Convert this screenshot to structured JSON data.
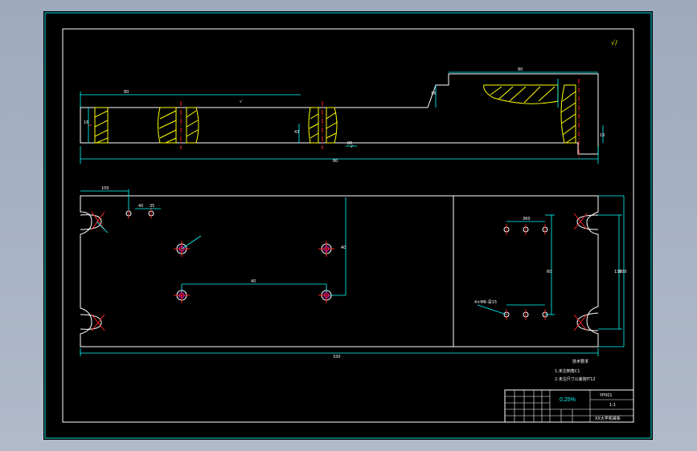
{
  "drawing": {
    "top_view": {
      "dims": [
        "80",
        "80",
        "16",
        "16",
        "80",
        "16",
        "43",
        "80"
      ],
      "roughness": [
        "√",
        "√"
      ]
    },
    "plan_view": {
      "dims": [
        "100",
        "40",
        "35",
        "40",
        "40",
        "330",
        "130",
        "100",
        "60",
        "360"
      ],
      "hole_note": "4×M8-深15"
    },
    "notes": {
      "heading": "技术要求",
      "lines": [
        "1.未注倒角C1",
        "2.未注尺寸公差按IT12"
      ]
    },
    "corner_mark": "√/",
    "title_block": {
      "part_code": "0.25%",
      "name": "YP001",
      "scale": "1:1",
      "school": "XX大学机械系"
    }
  },
  "colors": {
    "background": "#000000",
    "border": "#ffffff",
    "outline": "#ffffff",
    "dimension": "#00ffff",
    "centerline": "#ff0000",
    "hatch": "#ffff00",
    "hole": "#ff00ff",
    "text": "#ffffff"
  }
}
